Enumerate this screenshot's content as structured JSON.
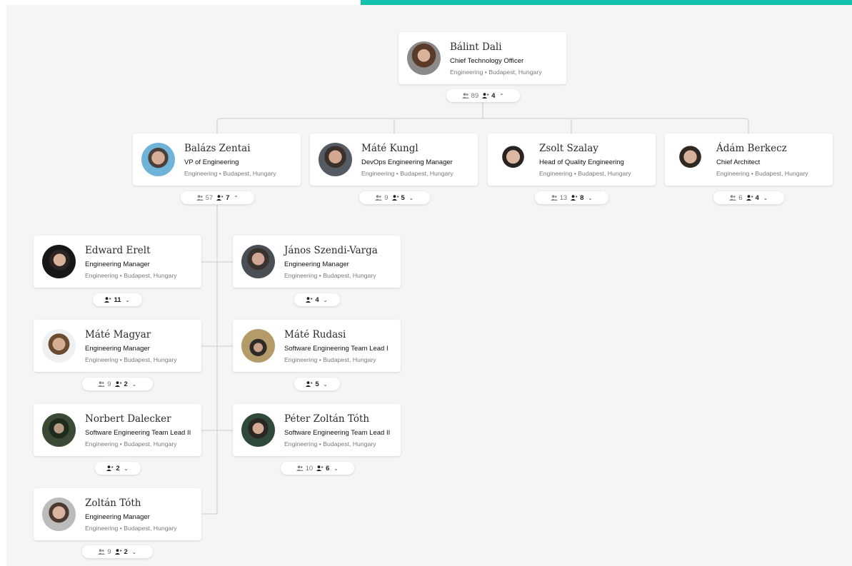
{
  "colors": {
    "accent": "#12c2ad",
    "background": "#f5f5f5",
    "card": "#ffffff",
    "connector": "#d3d3d3"
  },
  "icons": {
    "total_reports": "people-icon",
    "direct_reports": "person-arrow-icon",
    "expanded": "chevron-up-icon",
    "collapsed": "chevron-down-icon"
  },
  "root": {
    "name": "Bálint Dali",
    "role": "Chief Technology Officer",
    "location": "Engineering • Budapest, Hungary",
    "total_reports": "89",
    "direct_reports": "4",
    "chevron": "⌃"
  },
  "level1": [
    {
      "name": "Balázs Zentai",
      "role": "VP of Engineering",
      "location": "Engineering • Budapest, Hungary",
      "total_reports": "57",
      "direct_reports": "7",
      "chevron": "⌃"
    },
    {
      "name": "Máté Kungl",
      "role": "DevOps Engineering Manager",
      "location": "Engineering • Budapest, Hungary",
      "total_reports": "9",
      "direct_reports": "5",
      "chevron": "⌄"
    },
    {
      "name": "Zsolt Szalay",
      "role": "Head of Quality Engineering",
      "location": "Engineering • Budapest, Hungary",
      "total_reports": "13",
      "direct_reports": "8",
      "chevron": "⌄"
    },
    {
      "name": "Ádám Berkecz",
      "role": "Chief Architect",
      "location": "Engineering • Budapest, Hungary",
      "total_reports": "6",
      "direct_reports": "4",
      "chevron": "⌄"
    }
  ],
  "level2": [
    {
      "name": "Edward Erelt",
      "role": "Engineering Manager",
      "location": "Engineering • Budapest, Hungary",
      "total_reports": "",
      "direct_reports": "11",
      "chevron": "⌄"
    },
    {
      "name": "János Szendi-Varga",
      "role": "Engineering Manager",
      "location": "Engineering • Budapest, Hungary",
      "total_reports": "",
      "direct_reports": "4",
      "chevron": "⌄"
    },
    {
      "name": "Máté Magyar",
      "role": "Engineering Manager",
      "location": "Engineering • Budapest, Hungary",
      "total_reports": "9",
      "direct_reports": "2",
      "chevron": "⌄"
    },
    {
      "name": "Máté Rudasi",
      "role": "Software Engineering Team Lead I",
      "location": "Engineering • Budapest, Hungary",
      "total_reports": "",
      "direct_reports": "5",
      "chevron": "⌄"
    },
    {
      "name": "Norbert Dalecker",
      "role": "Software Engineering Team Lead II",
      "location": "Engineering • Budapest, Hungary",
      "total_reports": "",
      "direct_reports": "2",
      "chevron": "⌄"
    },
    {
      "name": "Péter Zoltán Tóth",
      "role": "Software Engineering Team Lead II",
      "location": "Engineering • Budapest, Hungary",
      "total_reports": "10",
      "direct_reports": "6",
      "chevron": "⌄"
    },
    {
      "name": "Zoltán Tóth",
      "role": "Engineering Manager",
      "location": "Engineering • Budapest, Hungary",
      "total_reports": "9",
      "direct_reports": "2",
      "chevron": "⌄"
    }
  ]
}
